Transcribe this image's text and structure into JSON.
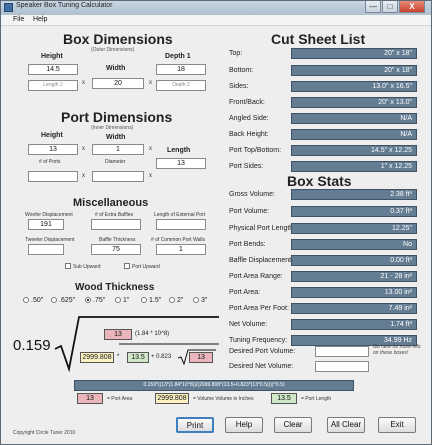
{
  "window": {
    "title": "Speaker Box Tuning Calculator",
    "minimize": "—",
    "maximize": "□",
    "close": "X"
  },
  "menu": [
    "File",
    "Help"
  ],
  "box": {
    "title": "Box Dimensions",
    "subtitle": "(Outer Dimensions)",
    "height_label": "Height",
    "height_value": "14.5",
    "width_label": "Width",
    "width_value": "20",
    "depth1_label": "Depth 1",
    "depth1_value": "18",
    "length2_label": "Length 2",
    "depth2_label": "Depth 2",
    "times": "x"
  },
  "port": {
    "title": "Port Dimensions",
    "subtitle": "(Inner Dimensions)",
    "height_label": "Height",
    "height_value": "13",
    "width_label": "Width",
    "width_value": "1",
    "length_label": "Length",
    "length_value": "13",
    "num_ports_label": "# of Ports",
    "diameter_label": "Diameter",
    "times": "x"
  },
  "misc": {
    "title": "Miscellaneous",
    "woofer_disp_label": "Woofer Displacement",
    "woofer_disp_value": "191",
    "num_extra_baffles_label": "# of Extra Baffles",
    "ext_port_length_label": "Length of External Port",
    "tweeter_disp_label": "Tweeter Displacement",
    "baffle_thickness_label": "Baffle Thickness",
    "baffle_thickness_value": "75",
    "common_port_walls_label": "# of Common Port Walls",
    "common_port_walls_value": "1",
    "sub_upward_label": "Sub Upward",
    "port_upward_label": "Port Upward"
  },
  "wood": {
    "title": "Wood Thickness",
    "options": [
      ".50\"",
      ".625\"",
      ".75\"",
      "1\"",
      "1.5\"",
      "2\"",
      "3\""
    ],
    "selected": ".75\""
  },
  "formula": {
    "constant": "0.159",
    "top_value": "13",
    "top_text": "(1.84 * 10^8)",
    "volume_value": "2999.808",
    "star": "*",
    "length_value": "13.5",
    "minus": "+  0.823",
    "sqrt_value": "13",
    "expression": "0.159*((13*(1.84*10^8))/(2999.808*(13.5+0.823*(13*0.5))))^0.5)",
    "legend_port_area": "= Port Area",
    "legend_volume": "= Volume Volume in Inches",
    "legend_length": "= Port Length"
  },
  "cut_sheet": {
    "title": "Cut Sheet List",
    "rows": [
      {
        "label": "Top:",
        "value": "20\" x 18\""
      },
      {
        "label": "Bottom:",
        "value": "20\" x 18\""
      },
      {
        "label": "Sides:",
        "value": "13.0\" x 16.5\""
      },
      {
        "label": "Front/Back:",
        "value": "20\" x 13.0\""
      },
      {
        "label": "Angled Side:",
        "value": "N/A"
      },
      {
        "label": "Back Height:",
        "value": "N/A"
      },
      {
        "label": "Port Top/Bottom:",
        "value": "14.5\" x 12.25"
      },
      {
        "label": "Port Sides:",
        "value": "1\" x 12.25"
      }
    ]
  },
  "box_stats": {
    "title": "Box Stats",
    "rows": [
      {
        "label": "Gross Volume:",
        "value": "2.38 ft³"
      },
      {
        "label": "Port Volume:",
        "value": "0.37 ft³"
      },
      {
        "label": "Physical Port Length:",
        "value": "12.25\""
      },
      {
        "label": "Port Bends:",
        "value": "No"
      },
      {
        "label": "Baffle Displacement:",
        "value": "0.00 ft³"
      },
      {
        "label": "Port Area Range:",
        "value": "21 - 28 in²"
      },
      {
        "label": "Port Area:",
        "value": "13.00 in²"
      },
      {
        "label": "Port Area Per Foot:",
        "value": "7.49 in²"
      },
      {
        "label": "Net Volume:",
        "value": "1.74 ft³"
      },
      {
        "label": "Tuning Frequency:",
        "value": "34.99 Hz"
      }
    ],
    "desired_port_volume_label": "Desired Port Volume:",
    "desired_net_volume_label": "Desired Net Volume:",
    "note": "Go here for more info on these boxes!"
  },
  "buttons": {
    "print": "Print",
    "help": "Help",
    "clear": "Clear",
    "all_clear": "All Clear",
    "exit": "Exit"
  },
  "copyright": "Copyright Circle Tuner 2010"
}
